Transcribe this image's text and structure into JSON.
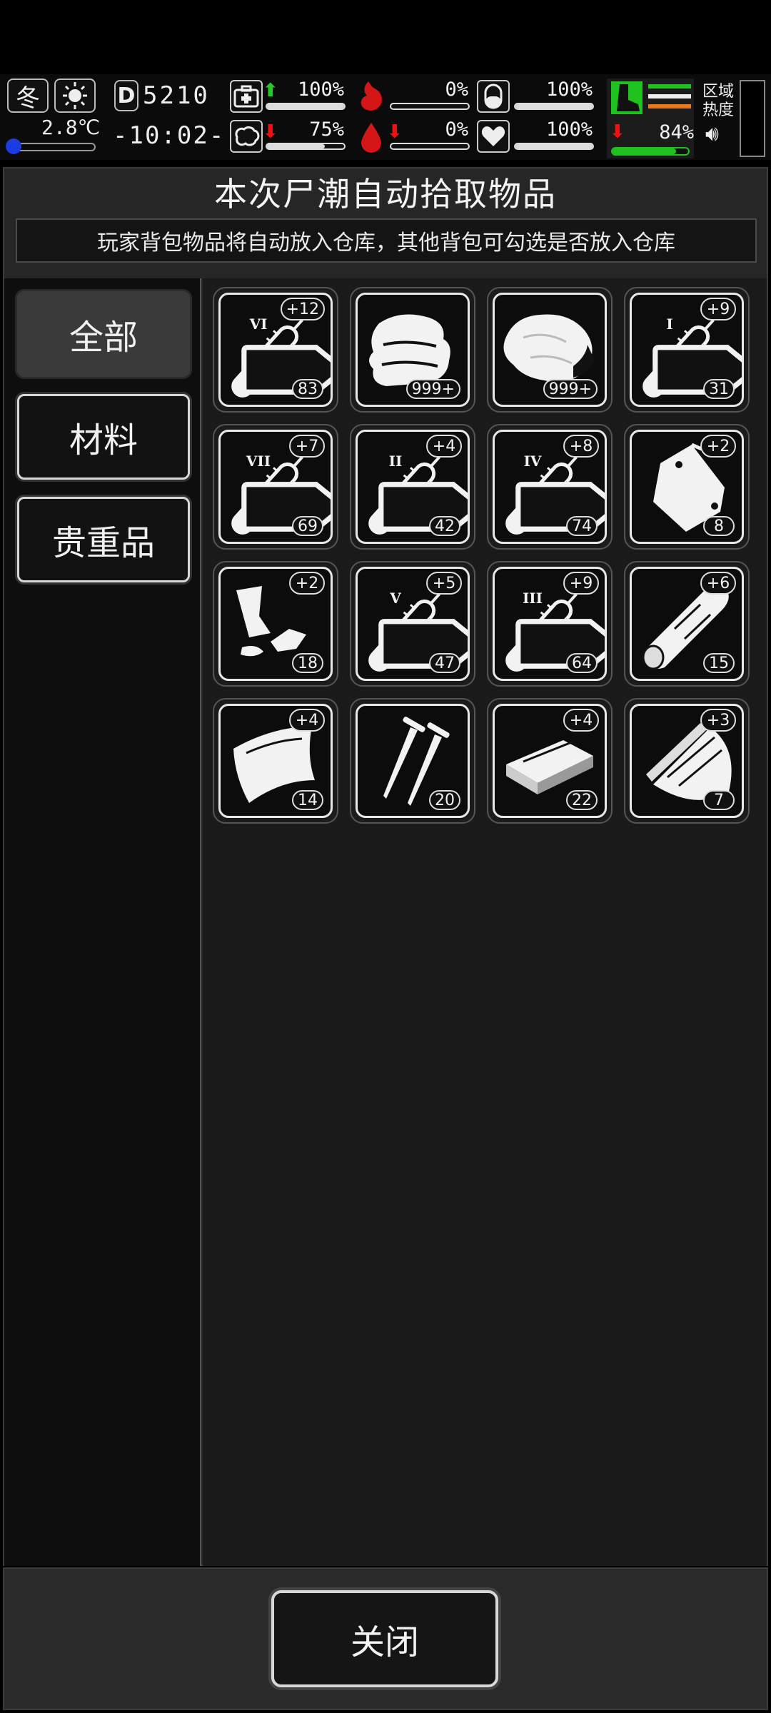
{
  "status": {
    "season": "冬",
    "temperature": "2.8℃",
    "day": "5210",
    "day_prefix": "D",
    "clock": "-10:02-",
    "health": "100%",
    "hunger": "0%",
    "pill": "100%",
    "stamina": "84%",
    "mood": "75%",
    "blood": "0%",
    "heart": "100%",
    "zone_label_1": "区域",
    "zone_label_2": "热度",
    "fills": {
      "health": 1.0,
      "hunger": 0.0,
      "pill": 1.0,
      "stamina": 0.84,
      "mood": 0.75,
      "blood": 0.0,
      "heart": 1.0
    },
    "colors": {
      "up": "#22cc22",
      "down": "#ee1111",
      "stamina_icon": "#1fc21f",
      "stripe_orange": "#e87a1a"
    }
  },
  "dialog": {
    "title": "本次尸潮自动拾取物品",
    "subtitle": "玩家背包物品将自动放入仓库，其他背包可勾选是否放入仓库",
    "close_label": "关闭"
  },
  "categories": [
    {
      "label": "全部",
      "active": true
    },
    {
      "label": "材料",
      "active": false
    },
    {
      "label": "贵重品",
      "active": false
    }
  ],
  "items": [
    {
      "icon": "syringe-icon",
      "grade": "VI",
      "bonus": "+12",
      "count": "83",
      "fill": 0.55
    },
    {
      "icon": "cloth-icon",
      "grade": "",
      "bonus": "",
      "count": "999+"
    },
    {
      "icon": "meat-icon",
      "grade": "",
      "bonus": "",
      "count": "999+"
    },
    {
      "icon": "syringe-icon",
      "grade": "I",
      "bonus": "+9",
      "count": "31",
      "fill": 0.3
    },
    {
      "icon": "syringe-icon",
      "grade": "VII",
      "bonus": "+7",
      "count": "69",
      "fill": 0.6
    },
    {
      "icon": "syringe-icon",
      "grade": "II",
      "bonus": "+4",
      "count": "42",
      "fill": 0.35
    },
    {
      "icon": "syringe-icon",
      "grade": "IV",
      "bonus": "+8",
      "count": "74",
      "fill": 0.45
    },
    {
      "icon": "bag-icon",
      "grade": "",
      "bonus": "+2",
      "count": "8"
    },
    {
      "icon": "scrap-icon",
      "grade": "",
      "bonus": "+2",
      "count": "18"
    },
    {
      "icon": "syringe-icon",
      "grade": "V",
      "bonus": "+5",
      "count": "47",
      "fill": 0.5
    },
    {
      "icon": "syringe-icon",
      "grade": "III",
      "bonus": "+9",
      "count": "64",
      "fill": 0.55
    },
    {
      "icon": "wood-log-icon",
      "grade": "",
      "bonus": "+6",
      "count": "15"
    },
    {
      "icon": "leather-icon",
      "grade": "",
      "bonus": "+4",
      "count": "14"
    },
    {
      "icon": "nails-icon",
      "grade": "",
      "bonus": "",
      "count": "20"
    },
    {
      "icon": "plank-icon",
      "grade": "",
      "bonus": "+4",
      "count": "22"
    },
    {
      "icon": "wood-chips-icon",
      "grade": "",
      "bonus": "+3",
      "count": "7"
    }
  ]
}
